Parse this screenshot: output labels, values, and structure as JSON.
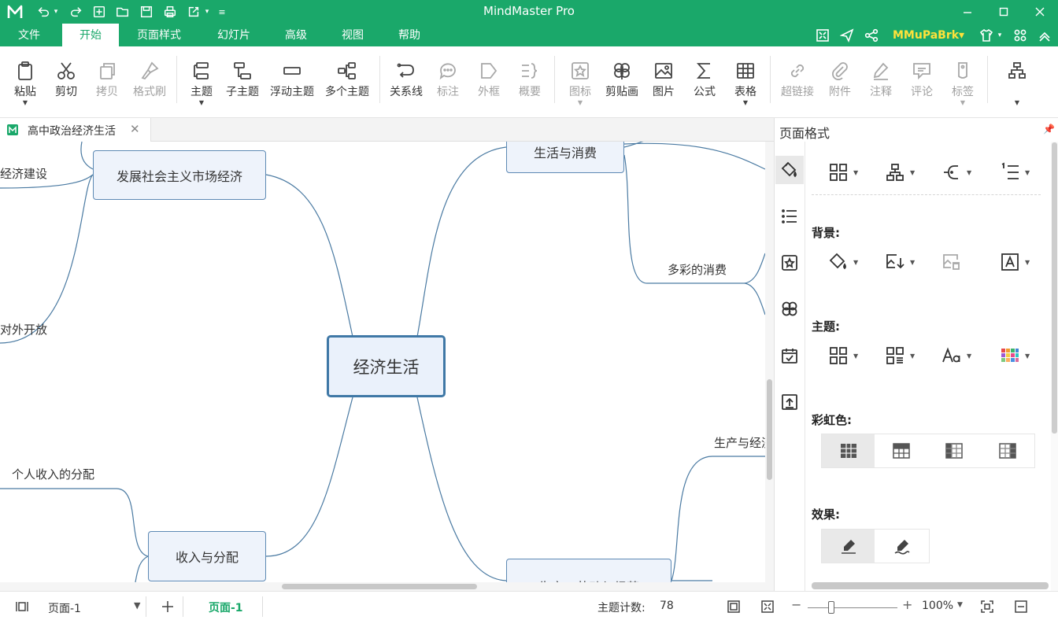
{
  "app": {
    "title": "MindMaster Pro"
  },
  "menu": {
    "tabs": [
      {
        "label": "文件"
      },
      {
        "label": "开始"
      },
      {
        "label": "页面样式"
      },
      {
        "label": "幻灯片"
      },
      {
        "label": "高级"
      },
      {
        "label": "视图"
      },
      {
        "label": "帮助"
      }
    ],
    "active_tab": "开始",
    "user": "MMuPaBrk▾"
  },
  "ribbon": {
    "paste": "粘贴",
    "cut": "剪切",
    "copy": "拷贝",
    "format_painter": "格式刷",
    "topic": "主题",
    "subtopic": "子主题",
    "floating_topic": "浮动主题",
    "multiple_topics": "多个主题",
    "relationship": "关系线",
    "callout": "标注",
    "boundary": "外框",
    "summary": "概要",
    "icon": "图标",
    "clipart": "剪贴画",
    "picture": "图片",
    "formula": "公式",
    "table": "表格",
    "hyperlink": "超链接",
    "attachment": "附件",
    "note": "注释",
    "comment": "评论",
    "tag": "标签"
  },
  "document": {
    "tab_title": "高中政治经济生活"
  },
  "mindmap": {
    "central": "经济生活",
    "topics": {
      "market_economy": "发展社会主义市场经济",
      "life_consumption": "生活与消费",
      "income_distribution": "收入与分配",
      "production_labor": "生产、劳动与经营"
    },
    "subtopics": {
      "economic_construction": "经济建设",
      "opening_up": "对外开放",
      "colorful_consumption": "多彩的消费",
      "personal_income": "个人收入的分配",
      "production_economy": "生产与经济"
    }
  },
  "panel": {
    "title": "页面格式",
    "sections": {
      "background": "背景:",
      "theme": "主题:",
      "rainbow": "彩虹色:",
      "effects": "效果:"
    }
  },
  "status": {
    "page_select": "页面-1",
    "active_page": "页面-1",
    "topic_count_label": "主题计数:",
    "topic_count": "78",
    "zoom": "100%"
  },
  "colors": {
    "brand_green": "#1aa86a",
    "user_yellow": "#ffe23a",
    "topic_border": "#3f78a6"
  }
}
